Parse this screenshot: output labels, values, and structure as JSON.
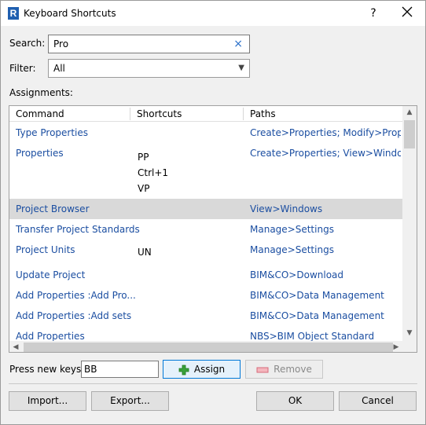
{
  "window": {
    "title": "Keyboard Shortcuts",
    "app_icon_letter": "R",
    "help_label": "?"
  },
  "search": {
    "label": "Search:",
    "value": "Pro",
    "clear_symbol": "×"
  },
  "filter": {
    "label": "Filter:",
    "value": "All"
  },
  "assignments": {
    "label": "Assignments:",
    "columns": [
      "Command",
      "Shortcuts",
      "Paths"
    ],
    "rows": [
      {
        "command": "Type Properties",
        "shortcuts": [],
        "path": "Create>Properties; Modify>Prope..."
      },
      {
        "command": "Properties",
        "shortcuts": [
          "PP",
          "Ctrl+1",
          "VP"
        ],
        "path": "Create>Properties; View>Windo..."
      },
      {
        "command": "Project Browser",
        "shortcuts": [],
        "path": "View>Windows",
        "selected": true
      },
      {
        "command": "Transfer Project Standards",
        "shortcuts": [],
        "path": "Manage>Settings"
      },
      {
        "command": "Project Units",
        "shortcuts": [
          "UN"
        ],
        "path": "Manage>Settings"
      },
      {
        "command": "Update Project",
        "shortcuts": [],
        "path": "BIM&CO>Download"
      },
      {
        "command": "Add Properties :Add Pro...",
        "shortcuts": [],
        "path": "BIM&CO>Data Management"
      },
      {
        "command": "Add Properties :Add sets",
        "shortcuts": [],
        "path": "BIM&CO>Data Management"
      },
      {
        "command": "Add Properties",
        "shortcuts": [],
        "path": "NBS>BIM Object Standard"
      }
    ]
  },
  "press_keys": {
    "label": "Press new keys:",
    "value": "BB"
  },
  "buttons": {
    "assign": "Assign",
    "remove": "Remove",
    "import": "Import...",
    "export": "Export...",
    "ok": "OK",
    "cancel": "Cancel"
  },
  "colors": {
    "link": "#1b4ea1",
    "selection": "#d9d9d9",
    "accent": "#0078d7",
    "assign_icon": "#3aa13a",
    "remove_icon": "#e05a6a"
  }
}
